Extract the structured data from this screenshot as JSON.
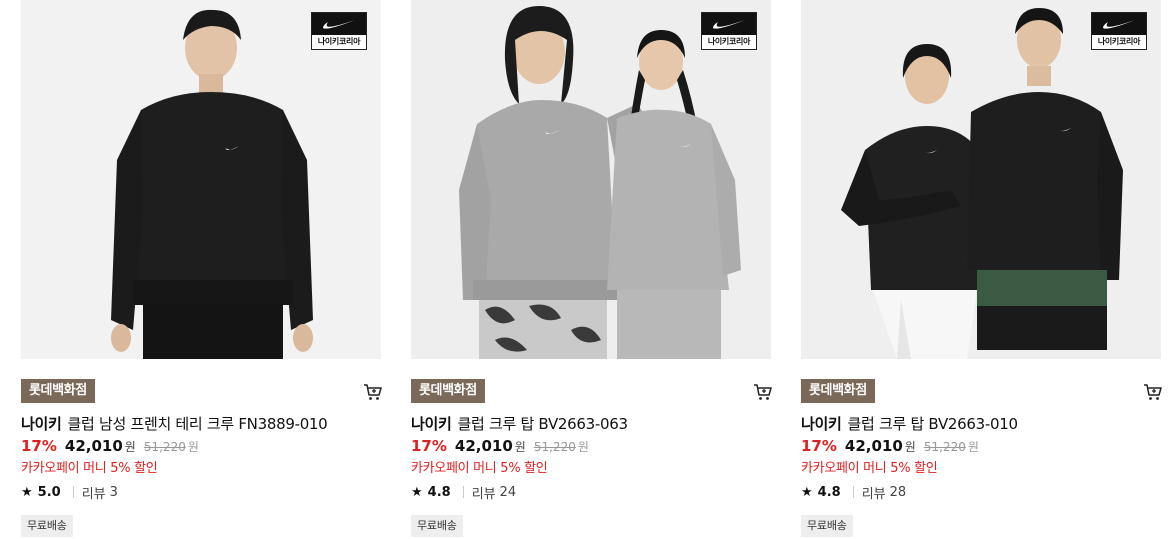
{
  "badge_text": "나이키코리아",
  "colors": {
    "store_tag": "#7a6858",
    "discount": "#e02020"
  },
  "products": [
    {
      "store": "롯데백화점",
      "brand": "나이키",
      "name": "클럽 남성 프렌치 테리 크루 FN3889-010",
      "discount": "17%",
      "price": "42,010",
      "won": "원",
      "original_price": "51,220",
      "promo": "카카오페이 머니 5% 할인",
      "rating": "5.0",
      "review_label": "리뷰",
      "review_count": "3",
      "shipping": "무료배송"
    },
    {
      "store": "롯데백화점",
      "brand": "나이키",
      "name": "클럽 크루 탑 BV2663-063",
      "discount": "17%",
      "price": "42,010",
      "won": "원",
      "original_price": "51,220",
      "promo": "카카오페이 머니 5% 할인",
      "rating": "4.8",
      "review_label": "리뷰",
      "review_count": "24",
      "shipping": "무료배송"
    },
    {
      "store": "롯데백화점",
      "brand": "나이키",
      "name": "클럽 크루 탑 BV2663-010",
      "discount": "17%",
      "price": "42,010",
      "won": "원",
      "original_price": "51,220",
      "promo": "카카오페이 머니 5% 할인",
      "rating": "4.8",
      "review_label": "리뷰",
      "review_count": "28",
      "shipping": "무료배송"
    }
  ]
}
